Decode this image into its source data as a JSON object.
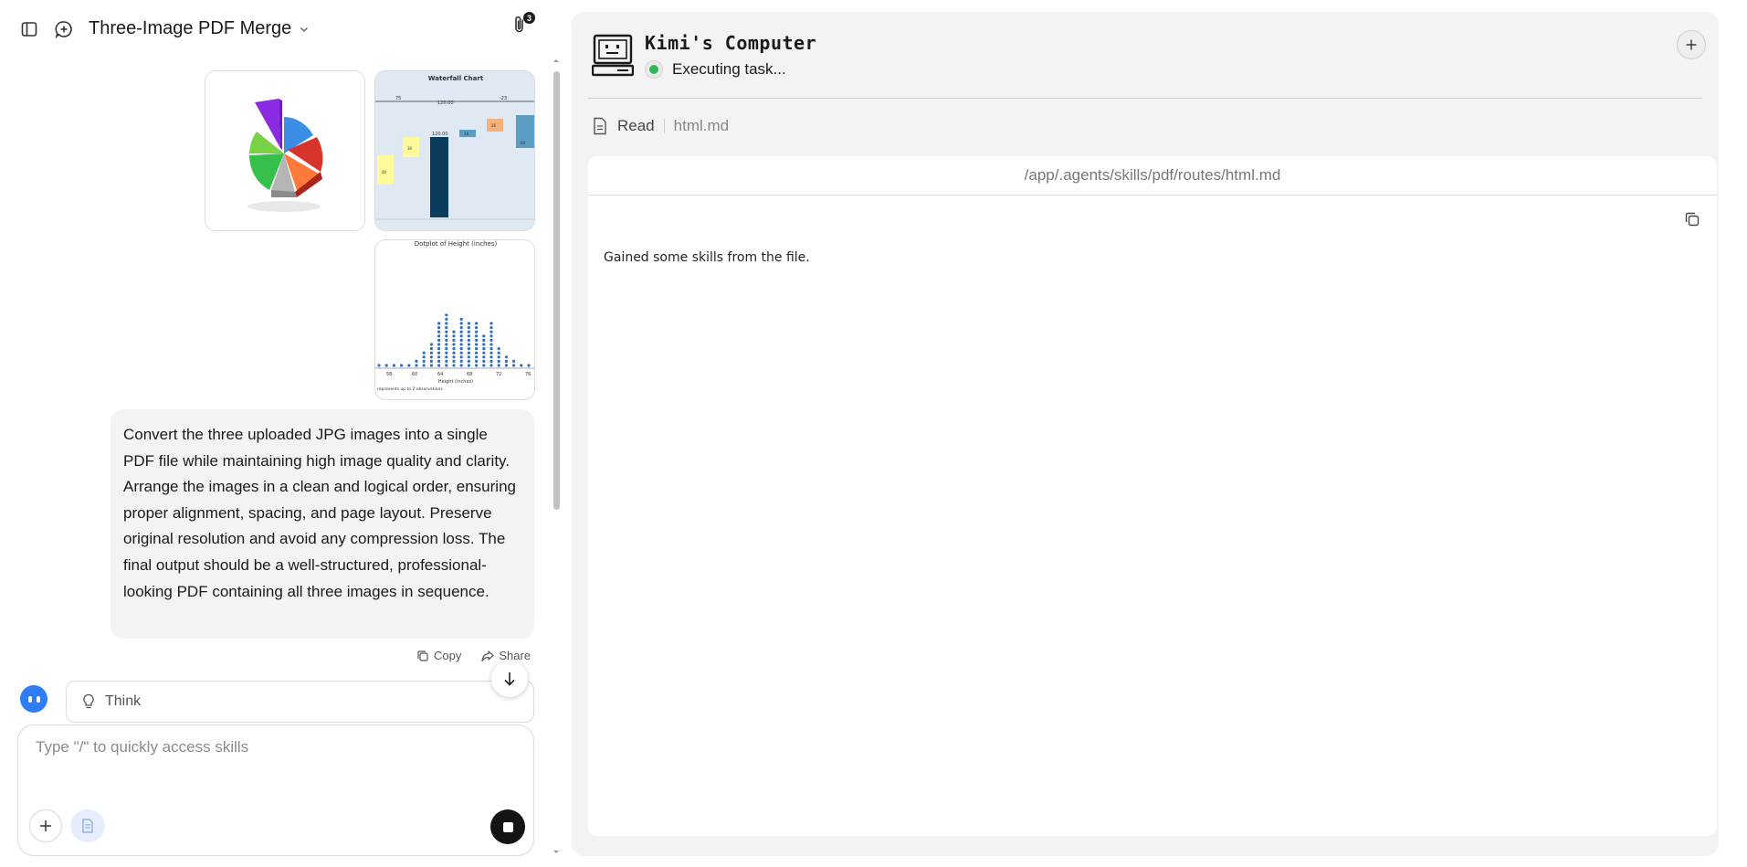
{
  "header": {
    "title": "Three-Image PDF Merge",
    "attachment_count": "3"
  },
  "attachments": {
    "pie_image": "3d-pie-chart",
    "waterfall": {
      "title": "Waterfall Chart",
      "labels": [
        "75",
        "120.00",
        "-23"
      ],
      "bar_labels": [
        "40",
        "30",
        "120.00",
        "18",
        "26",
        "60"
      ]
    },
    "dotplot": {
      "title": "Dotplot of Height (inches)",
      "xaxis": "Height (inches)",
      "ticks": [
        "58",
        "60",
        "64",
        "68",
        "72",
        "76"
      ],
      "note": "represents up to 2 observations."
    }
  },
  "user_message": {
    "text": "Convert the three uploaded JPG images into a single PDF file while maintaining high image quality and clarity. Arrange the images in a clean and logical order, ensuring proper alignment, spacing, and page layout. Preserve original resolution and avoid any compression loss. The final output should be a well-structured, professional-looking PDF containing all three images in sequence."
  },
  "message_actions": {
    "copy": "Copy",
    "share": "Share"
  },
  "assistant": {
    "think_label": "Think"
  },
  "composer": {
    "placeholder": "Type \"/\" to quickly access skills"
  },
  "computer": {
    "title": "Kimi's Computer",
    "status": "Executing task...",
    "action": "Read",
    "action_file": "html.md",
    "file_path": "/app/.agents/skills/pdf/routes/html.md",
    "file_content": "Gained some skills from the file."
  },
  "colors": {
    "status_green": "#2dbb5a",
    "accent_blue": "#2f7df6",
    "panel_bg": "#f3f3f3"
  }
}
